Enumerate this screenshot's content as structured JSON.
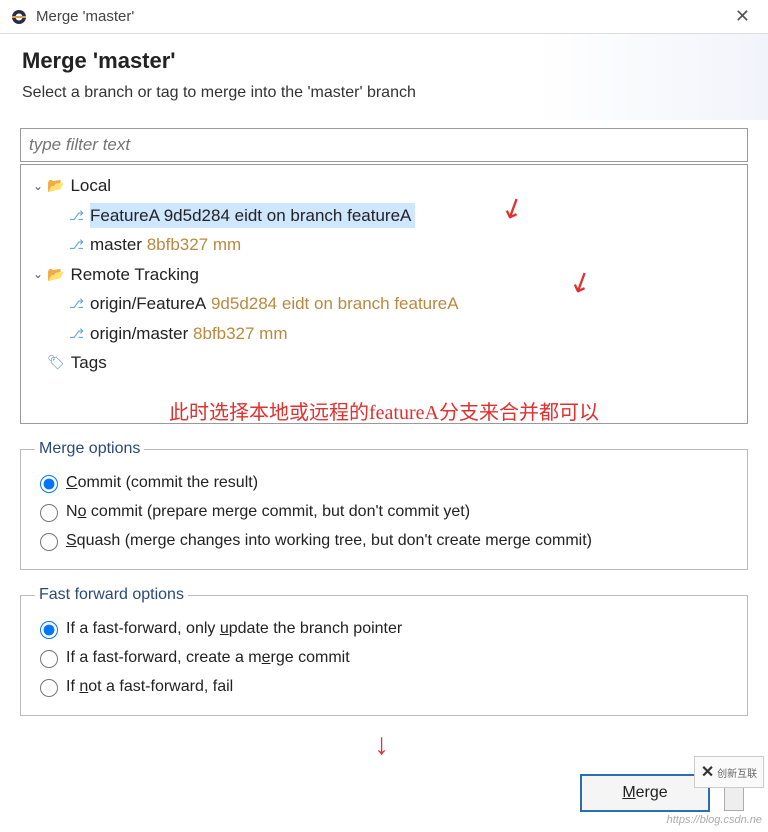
{
  "titlebar": {
    "title": "Merge 'master'"
  },
  "header": {
    "title": "Merge 'master'",
    "subtitle": "Select a branch or tag to merge into the 'master' branch"
  },
  "filter": {
    "placeholder": "type filter text"
  },
  "tree": {
    "local_label": "Local",
    "featureA_name": "FeatureA",
    "featureA_hash": "9d5d284 eidt on branch featureA",
    "master_name": "master",
    "master_hash": "8bfb327 mm",
    "remote_label": "Remote Tracking",
    "origin_featureA_name": "origin/FeatureA",
    "origin_featureA_hash": "9d5d284 eidt on branch featureA",
    "origin_master_name": "origin/master",
    "origin_master_hash": "8bfb327 mm",
    "tags_label": "Tags"
  },
  "annotation": "此时选择本地或远程的featureA分支来合并都可以",
  "merge_options": {
    "legend": "Merge options",
    "commit_pre": "C",
    "commit_post": "ommit (commit the result)",
    "nocommit_pre": "N",
    "nocommit_mid": "o",
    "nocommit_post": " commit (prepare merge commit, but don't commit yet)",
    "squash_pre": "S",
    "squash_post": "quash (merge changes into working tree, but don't create merge commit)"
  },
  "ff_options": {
    "legend": "Fast forward options",
    "opt1_pre": "If a fast-forward, only ",
    "opt1_u": "u",
    "opt1_post": "pdate the branch pointer",
    "opt2_pre": "If a fast-forward, create a m",
    "opt2_u": "e",
    "opt2_post": "rge commit",
    "opt3_pre": "If ",
    "opt3_u": "n",
    "opt3_post": "ot a fast-forward, fail"
  },
  "buttons": {
    "merge_pre": "",
    "merge_u": "M",
    "merge_post": "erge"
  },
  "watermark": "https://blog.csdn.ne",
  "logo_text": "创新互联"
}
